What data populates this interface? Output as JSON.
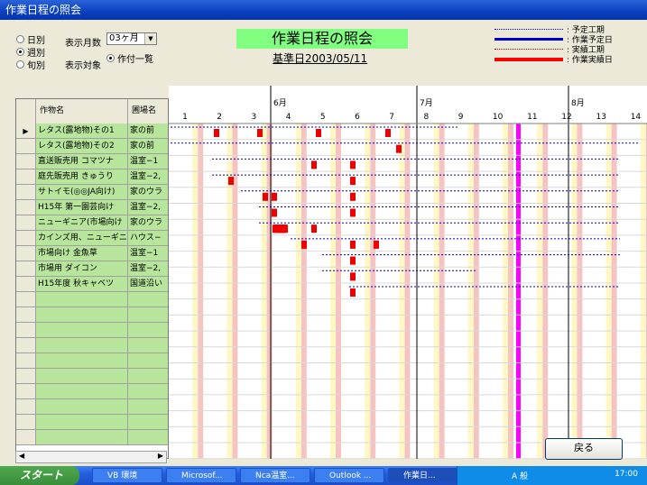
{
  "window": {
    "title": "作業日程の照会"
  },
  "view_mode": {
    "options": [
      {
        "label": "日別",
        "selected": false
      },
      {
        "label": "週別",
        "selected": true
      },
      {
        "label": "旬別",
        "selected": false
      }
    ]
  },
  "months_count": {
    "label": "表示月数",
    "value": "03ヶ月"
  },
  "target": {
    "label": "表示対象",
    "option_label": "作付一覧",
    "selected": true
  },
  "header": {
    "title": "作業日程の照会",
    "base_date": "基準日2003/05/11"
  },
  "legend": [
    {
      "label": ": 予定工期",
      "color": "#0000cc",
      "style": "dotted"
    },
    {
      "label": ": 作業予定日",
      "color": "#0000cc",
      "style": "solid"
    },
    {
      "label": ": 実績工期",
      "color": "#cc0000",
      "style": "dotted"
    },
    {
      "label": ": 作業実績日",
      "color": "#ff0000",
      "style": "solid"
    }
  ],
  "grid": {
    "columns": [
      "作物名",
      "圃場名"
    ],
    "rows": [
      {
        "crop": "レタス(露地物)その1",
        "field": "家の前",
        "current": true
      },
      {
        "crop": "レタス(露地物)その2",
        "field": "家の前",
        "current": false
      },
      {
        "crop": "直送販売用 コマツナ",
        "field": "温室−1",
        "current": false
      },
      {
        "crop": "庭先販売用 きゅうり",
        "field": "温室−2,",
        "current": false
      },
      {
        "crop": "サトイモ(◎◎JA向け)",
        "field": "家のウラ",
        "current": false
      },
      {
        "crop": "H15年 第一園芸向け",
        "field": "温室−2,",
        "current": false
      },
      {
        "crop": "ニューギニア(市場向け",
        "field": "家のウラ",
        "current": false
      },
      {
        "crop": "カインズ用、ニューギニ",
        "field": "ハウス−",
        "current": false
      },
      {
        "crop": "市場向け 金魚草",
        "field": "温室−1",
        "current": false
      },
      {
        "crop": "市場用 ダイコン",
        "field": "温室−2,",
        "current": false
      },
      {
        "crop": "H15年度 秋キャベツ",
        "field": "国道沿い",
        "current": false
      }
    ]
  },
  "gantt": {
    "months": [
      "6月",
      "7月",
      "8月"
    ],
    "weeks": [
      "1",
      "2",
      "3",
      "4",
      "5",
      "6",
      "7",
      "8",
      "9",
      "10",
      "11",
      "12",
      "13",
      "14"
    ],
    "highlight_week": 11
  },
  "buttons": {
    "back": "戻る"
  },
  "taskbar": {
    "start": "スタート",
    "items": [
      "VB 環境",
      "Microsof...",
      "Nca温室...",
      "Outlook ...",
      "作業日..."
    ],
    "clock": "17:00",
    "ime": "A 般"
  }
}
